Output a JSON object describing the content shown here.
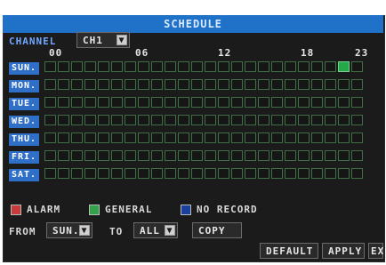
{
  "title": "SCHEDULE",
  "channel": {
    "label": "CHANNEL",
    "value": "CH1"
  },
  "hours": [
    "00",
    "06",
    "12",
    "18",
    "23"
  ],
  "days": [
    "SUN.",
    "MON.",
    "TUE.",
    "WED.",
    "THU.",
    "FRI.",
    "SAT."
  ],
  "schedule": {
    "cells_per_day": 24,
    "recorded_cells": [
      {
        "day": "SUN.",
        "hour": 22,
        "mode": "GENERAL"
      }
    ]
  },
  "legend": [
    {
      "label": "ALARM",
      "color": "#c93a3a"
    },
    {
      "label": "GENERAL",
      "color": "#33a14a"
    },
    {
      "label": "NO RECORD",
      "color": "#1b3f9d"
    }
  ],
  "copy": {
    "from_label": "FROM",
    "from_value": "SUN.",
    "to_label": "TO",
    "to_value": "ALL",
    "copy_label": "COPY"
  },
  "buttons": {
    "default": "DEFAULT",
    "apply": "APPLY",
    "exit": "EXIT"
  },
  "colors": {
    "title_bar": "#1f72c8",
    "panel_bg": "#1b1b1b",
    "day_label_bg": "#2f6fc8",
    "grid_line": "#3f6f44",
    "record_fill": "#23a84a"
  }
}
